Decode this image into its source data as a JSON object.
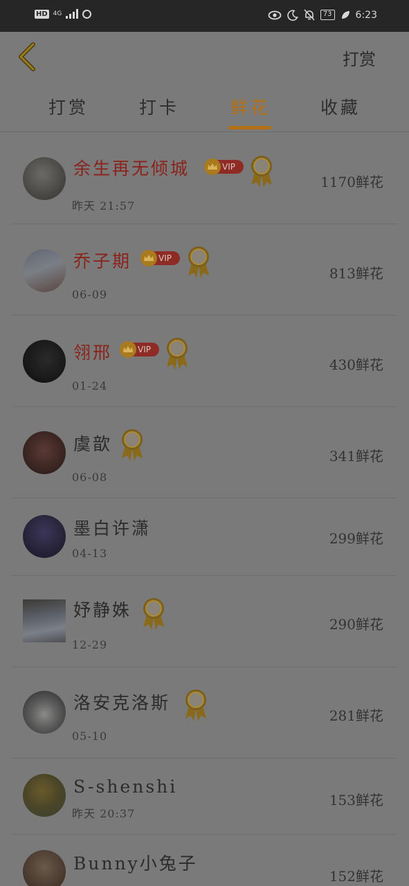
{
  "status_bar": {
    "hd": "HD",
    "network": "4G",
    "battery": "73",
    "time": "6:23"
  },
  "header": {
    "right_label": "打赏"
  },
  "tabs": [
    {
      "label": "打赏",
      "active": false
    },
    {
      "label": "打卡",
      "active": false
    },
    {
      "label": "鲜花",
      "active": true
    },
    {
      "label": "收藏",
      "active": false
    }
  ],
  "colors": {
    "accent": "#b36f14",
    "vip_name": "#8a231c",
    "background": "#7a7a7a"
  },
  "rows": [
    {
      "name": "余生再无倾城",
      "date": "昨天 21:57",
      "amount": "1170鲜花",
      "vip": true,
      "vip_label": "VIP",
      "medal": true
    },
    {
      "name": "乔子期",
      "date": "06-09",
      "amount": "813鲜花",
      "vip": true,
      "vip_label": "VIP",
      "medal": true
    },
    {
      "name": "翎邢",
      "date": "01-24",
      "amount": "430鲜花",
      "vip": true,
      "vip_label": "VIP",
      "medal": true
    },
    {
      "name": "虞歆",
      "date": "06-08",
      "amount": "341鲜花",
      "vip": false,
      "medal": true
    },
    {
      "name": "墨白许潇",
      "date": "04-13",
      "amount": "299鲜花",
      "vip": false,
      "medal": false
    },
    {
      "name": "妤静姝",
      "date": "12-29",
      "amount": "290鲜花",
      "vip": false,
      "medal": true
    },
    {
      "name": "洛安克洛斯",
      "date": "05-10",
      "amount": "281鲜花",
      "vip": false,
      "medal": true
    },
    {
      "name": "S-shenshi",
      "date": "昨天 20:37",
      "amount": "153鲜花",
      "vip": false,
      "medal": false
    },
    {
      "name": "Bunny小兔子",
      "date": "",
      "amount": "152鲜花",
      "vip": false,
      "medal": false
    }
  ]
}
